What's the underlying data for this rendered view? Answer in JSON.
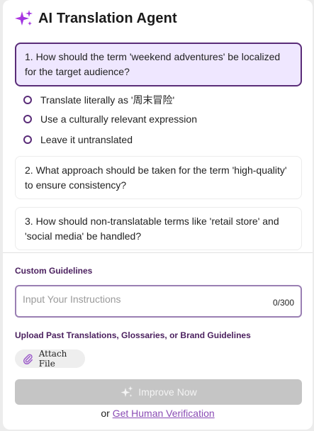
{
  "header": {
    "title": "AI Translation Agent",
    "icon": "sparkles-icon"
  },
  "questions": [
    {
      "text": "1. How should the term 'weekend adventures' be localized for the target audience?",
      "active": true,
      "options": [
        "Translate literally as '周末冒险'",
        "Use a culturally relevant expression",
        "Leave it untranslated"
      ]
    },
    {
      "text": "2. What approach should be taken for the term 'high-quality' to ensure consistency?",
      "active": false
    },
    {
      "text": "3. How should non-translatable terms like 'retail store' and 'social media' be handled?",
      "active": false
    }
  ],
  "guidelines": {
    "label": "Custom Guidelines",
    "placeholder": "Input Your Instructions",
    "counter": "0/300"
  },
  "upload": {
    "label": "Upload Past Translations, Glossaries, or Brand Guidelines",
    "attach_label": "Attach File",
    "icon": "paperclip-icon"
  },
  "improve_button": {
    "label": "Improve Now",
    "icon": "sparkles-icon"
  },
  "footer": {
    "prefix": "or",
    "link": "Get Human Verification"
  },
  "colors": {
    "accent": "#5a2c78",
    "active_bg": "#efe7ff",
    "link": "#8a4bb4",
    "disabled_button": "#c5c5c5"
  }
}
